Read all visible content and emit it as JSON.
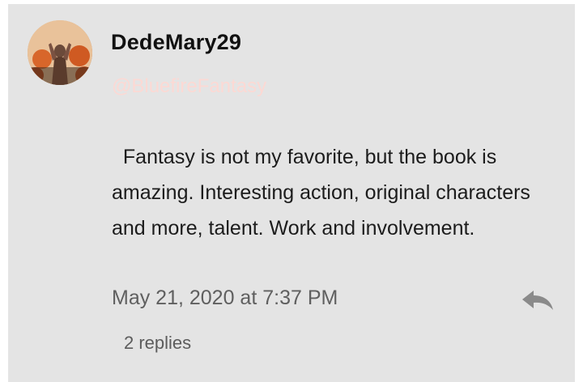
{
  "comment": {
    "username": "DedeMary29",
    "mention": "@BluefireFantasy",
    "body": "  Fantasy is not my favorite, but the book is amazing. Interesting action, original characters and more, talent. Work and involvement.",
    "timestamp": "May 21, 2020 at 7:37 PM",
    "replies_label": "2 replies",
    "reply_icon": "reply-arrow-icon",
    "colors": {
      "card_background": "#e4e4e4",
      "mention": "#fcd9d4",
      "timestamp": "#5f5f5f",
      "reply_icon": "#8a8a8a"
    }
  }
}
